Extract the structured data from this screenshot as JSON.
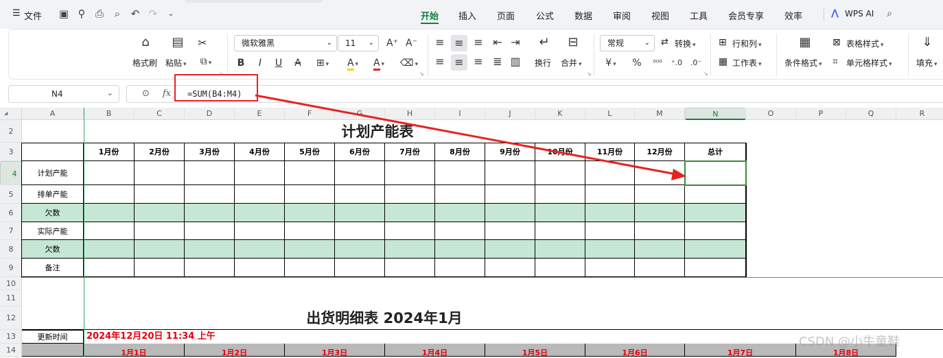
{
  "menubar": {
    "menu_label": "文件",
    "tabs": [
      "开始",
      "插入",
      "页面",
      "公式",
      "数据",
      "审阅",
      "视图",
      "工具",
      "会员专享",
      "效率"
    ],
    "active_tab": "开始",
    "wps_ai": "WPS AI"
  },
  "ribbon": {
    "format_painter": "格式刷",
    "paste": "粘贴",
    "font_name": "微软雅黑",
    "font_size": "11",
    "wrap": "换行",
    "merge": "合并",
    "number_format": "常规",
    "convert": "转换",
    "rows_cols": "行和列",
    "worksheet": "工作表",
    "cond_format": "条件格式",
    "table_style": "表格样式",
    "cell_style": "单元格样式",
    "fill": "填充"
  },
  "formula_bar": {
    "name_box": "N4",
    "fx": "fx",
    "formula": "=SUM(B4:M4)"
  },
  "columns": [
    "A",
    "B",
    "C",
    "D",
    "E",
    "F",
    "G",
    "H",
    "I",
    "J",
    "K",
    "L",
    "M",
    "N",
    "O",
    "P",
    "Q",
    "R"
  ],
  "selected_column": "N",
  "rows": [
    "2",
    "3",
    "4",
    "5",
    "6",
    "7",
    "8",
    "9",
    "10",
    "11",
    "12",
    "13",
    "14"
  ],
  "selected_row": "4",
  "table1": {
    "title": "计划产能表",
    "headers": [
      "",
      "1月份",
      "2月份",
      "3月份",
      "4月份",
      "5月份",
      "6月份",
      "7月份",
      "8月份",
      "9月份",
      "10月份",
      "11月份",
      "12月份",
      "总计"
    ],
    "row_labels": [
      "计划产能",
      "排单产能",
      "欠数",
      "实际产能",
      "欠数",
      "备注"
    ]
  },
  "table2": {
    "title": "出货明细表 2024年1月",
    "update_label": "更新时间",
    "update_value": "2024年12月20日 11:34 上午",
    "date_headers": [
      "1月1日",
      "1月2日",
      "1月3日",
      "1月4日",
      "1月5日",
      "1月6日",
      "1月7日",
      "1月8日"
    ]
  },
  "watermark": "CSDN @小牛童鞋",
  "colors": {
    "accent": "#11803f",
    "annotation": "#e8211f",
    "row_highlight": "#c6e7d3",
    "header_grey": "#b9b9b9",
    "date_red": "#e8000b"
  }
}
